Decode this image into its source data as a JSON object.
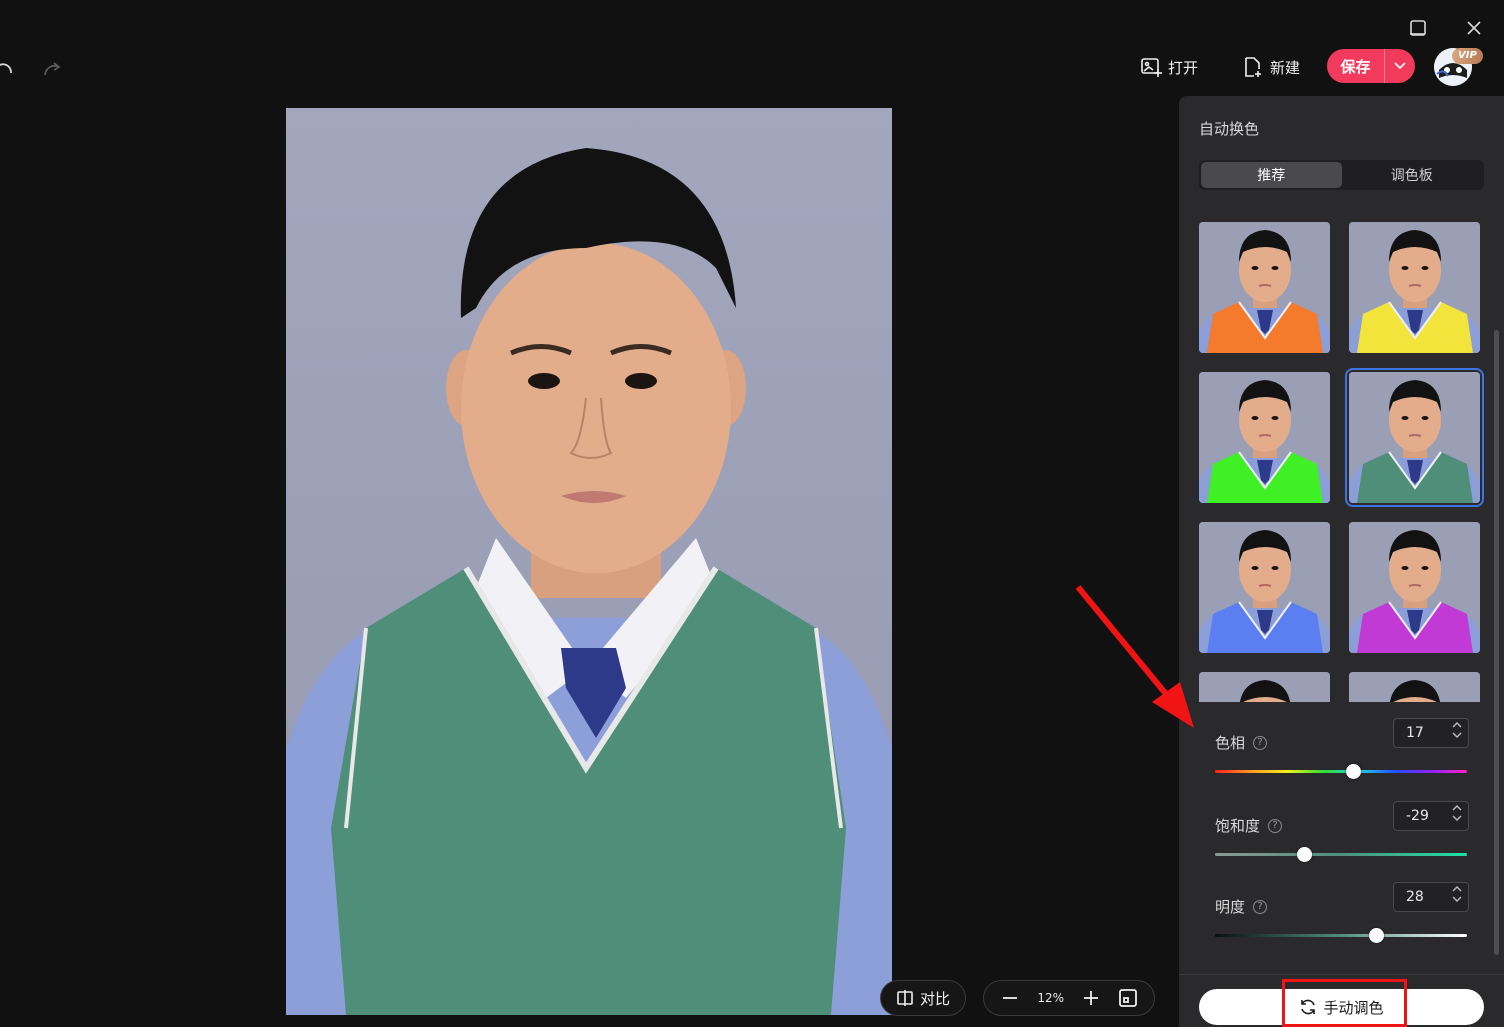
{
  "toolbar": {
    "open_label": "打开",
    "new_label": "新建",
    "save_label": "保存",
    "vip_badge": "VIP"
  },
  "panel": {
    "title": "自动换色",
    "tabs": [
      {
        "label": "推荐",
        "active": true
      },
      {
        "label": "调色板",
        "active": false
      }
    ],
    "swatches": [
      {
        "vest_color": "#f47a2c",
        "selected": false
      },
      {
        "vest_color": "#f2e43a",
        "selected": false
      },
      {
        "vest_color": "#3ff024",
        "selected": false
      },
      {
        "vest_color": "#4f8f79",
        "selected": true
      },
      {
        "vest_color": "#5b7ef0",
        "selected": false
      },
      {
        "vest_color": "#c13ad6",
        "selected": false
      }
    ],
    "hue": {
      "label": "色相",
      "value": "17",
      "slider_value": 17,
      "slider_min": -180,
      "slider_max": 180
    },
    "saturation": {
      "label": "饱和度",
      "value": "-29",
      "slider_value": -29,
      "slider_min": -100,
      "slider_max": 100
    },
    "brightness": {
      "label": "明度",
      "value": "28",
      "slider_value": 28,
      "slider_min": -100,
      "slider_max": 100
    },
    "manual_button": "手动调色"
  },
  "canvas": {
    "compare_label": "对比",
    "zoom": "12%"
  },
  "colors": {
    "accent_save": "#f23a5c",
    "selection_outline": "#3d74e0",
    "annotation_red": "#f01414"
  }
}
